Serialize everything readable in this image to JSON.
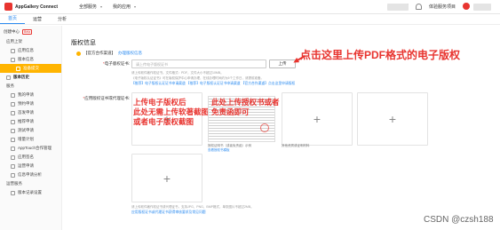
{
  "topbar": {
    "brand": "AppGallery Connect",
    "menu_all_services": "全部服务",
    "menu_my_projects": "我的应用",
    "right_text": "体验服务项目",
    "caret": "▾"
  },
  "tabs": [
    {
      "label": "首页"
    },
    {
      "label": "运营"
    },
    {
      "label": "分析"
    }
  ],
  "sidebar": {
    "group_label": "创建中心",
    "group_badge": "Beta",
    "section_app": "应用上架",
    "items": [
      {
        "label": "应用信息"
      },
      {
        "label": "版本信息"
      },
      {
        "label": "准备提交"
      },
      {
        "label": "版本历史"
      },
      {
        "label": "服务"
      },
      {
        "label": "我的申请"
      },
      {
        "label": "预约申请"
      },
      {
        "label": "首发申请"
      },
      {
        "label": "推荐申请"
      },
      {
        "label": "测试申请"
      },
      {
        "label": "增量计划"
      },
      {
        "label": "AppTouch合作管理"
      },
      {
        "label": "应用签名"
      },
      {
        "label": "运营申请"
      },
      {
        "label": "信息申请分析"
      },
      {
        "label": "运营服务"
      },
      {
        "label": "版本记录设置"
      }
    ]
  },
  "main": {
    "title": "版权信息",
    "row1_label": "【官方合作渠道】",
    "row1_link": "办理版权信息",
    "cert_label": "电子版权证书:",
    "cert_placeholder": "请上传电子版权证书",
    "upload_button": "上传",
    "hint1": "请上传软件著作权证书。文件格式：PDF，文件大小不超过10MB。",
    "hint2": "《电子版权认证证书》可在版权保护中心申请办理，在线办理时间约为5个工作日，请提前准备。",
    "hint_link": "【推荐】电子版权认证证书申请渠道    【推荐】电子版权认证证书申请渠道    【官方合作渠道】点击这里申请版权",
    "callout": "点击这里上传PDF格式的电子版权",
    "copyright_label": "应用版权证书或代理证书:",
    "slot1_note": "上传电子版权后\n此处无需上传软著截图\n或者电子版权截图",
    "slot2_note": "此处上传授权书或者\n免责函即可",
    "slot2_caption": "授权证明书（或者免责函）示例",
    "slot2_link": "查看授权书模板",
    "slot3_caption": "其他资质或证明材料",
    "bottom_hint": "请上传软件著作权证书或代理证书，支持JPG、PNG、BMP格式，单张图片不超过2MB。",
    "bottom_link": "应用版权证书或代理证书获得审核要求及常见问题"
  },
  "watermark": "CSDN @czsh188"
}
